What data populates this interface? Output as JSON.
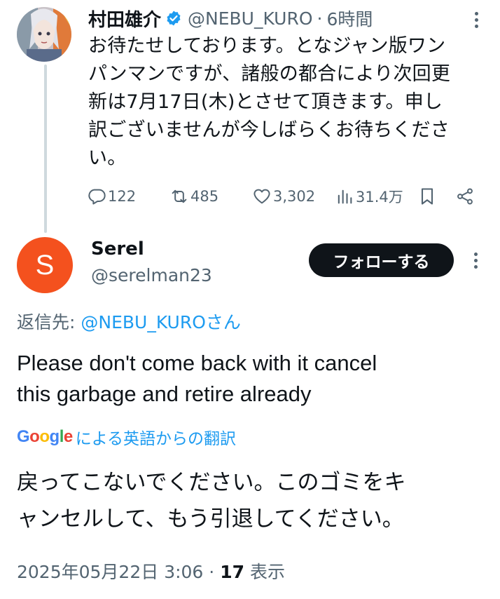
{
  "original_tweet": {
    "display_name": "村田雄介",
    "handle": "@NEBU_KURO",
    "separator": "·",
    "time_ago": "6時間",
    "text_lines": [
      "お待たせしております。となジャン版ワン",
      "パンマンですが、諸般の都合により次回更",
      "新は7月17日(木)とさせて頂きます。申し",
      "訳ございませんが今しばらくお待ちくださ",
      "い。"
    ],
    "actions": {
      "replies": "122",
      "retweets": "485",
      "likes": "3,302",
      "views": "31.4万"
    },
    "icons": [
      "verified-badge-icon",
      "more-icon",
      "reply-icon",
      "retweet-icon",
      "like-icon",
      "views-icon",
      "bookmark-icon",
      "share-icon"
    ]
  },
  "reply_tweet": {
    "avatar_letter": "S",
    "avatar_color": "#f4511e",
    "display_name": "Serel",
    "handle": "@serelman23",
    "follow_label": "フォローする",
    "reply_to_label": "返信先: ",
    "reply_to_handle": "@NEBU_KURO",
    "reply_to_suffix": "さん",
    "text_lines": [
      "Please don't come back with it cancel",
      "this garbage and retire already"
    ],
    "translation_provider": "Google",
    "translation_label": "による英語からの翻訳",
    "translated_lines": [
      "戻ってこないでください。このゴミをキ",
      "ャンセルして、もう引退してください。"
    ],
    "timestamp": "2025年05月22日 3:06",
    "meta_separator": " · ",
    "view_count": "17",
    "view_label": "表示"
  },
  "colors": {
    "text_primary": "#0f1419",
    "text_secondary": "#536471",
    "link_blue": "#1d9bf0",
    "thread_line": "#cfd9de",
    "follow_button_bg": "#0f1419"
  }
}
